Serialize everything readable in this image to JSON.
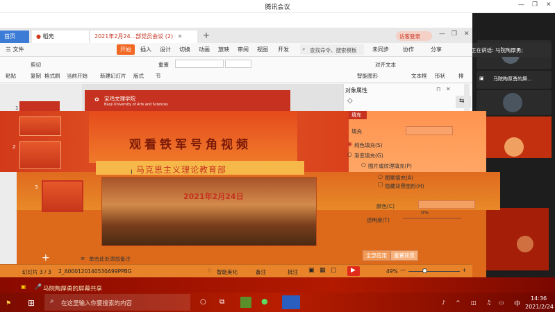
{
  "meeting": {
    "title": "腾讯会议",
    "speaking_label": "正在讲话: 马院陶厚勇;",
    "participant_name": "马院陶厚勇的屏...",
    "shared_screen_label": "马院陶厚勇的屏幕共享"
  },
  "wps": {
    "tabs": [
      "首页",
      "稻壳",
      "2021年2月24...部党员会议 (2)"
    ],
    "login_button": "访客登录",
    "menu": [
      "三 文件",
      "开始",
      "插入",
      "设计",
      "切换",
      "动画",
      "放映",
      "审阅",
      "视图",
      "开发"
    ],
    "search_placeholder": "查找命令、搜索模板",
    "sync_status": "未同步",
    "collab": "协作",
    "share": "分享",
    "toolbar": {
      "paste": "粘贴",
      "cut": "剪切",
      "copy": "复制",
      "format_painter": "格式刷",
      "from_current": "当前开始",
      "new_slide": "新建幻灯片",
      "layout": "版式",
      "section": "节",
      "reset": "重置",
      "text_box": "文本框",
      "shape": "形状",
      "arrange": "排",
      "align_text": "对齐文本",
      "smart_graphic": "智能图形"
    },
    "props": {
      "title": "对象属性",
      "fill_tab": "填充",
      "fill_label": "填充",
      "solid_fill": "纯色填充(S)",
      "gradient_fill": "渐变填充(G)",
      "picture_fill": "图片或纹理填充(P)",
      "pattern_fill": "图案填充(A)",
      "hide_bg": "隐藏背景图形(H)",
      "color_label": "颜色(C)",
      "transparency_label": "透明度(T)",
      "transparency_value": "0%",
      "apply_all": "全部应用",
      "reset_bg": "重置背景"
    },
    "slides": {
      "slide1_num": "1",
      "slide2_num": "2",
      "slide3_num": "3",
      "school_name": "宝鸡文理学院",
      "school_en": "Baoji University of Arts and Sciences",
      "main_title": "观看铁军号角视频",
      "subtitle": "马克思主义理论教育部",
      "date": "2021年2月24日"
    },
    "notes_placeholder": "单击此处添加备注",
    "status": {
      "slide_count": "幻灯片 3 / 3",
      "file": "2_A000120140530A99PPBG",
      "beautify": "智能美化",
      "notes": "备注",
      "comments": "批注",
      "zoom": "49%"
    }
  },
  "taskbar": {
    "search_placeholder": "在这里输入你要搜索的内容",
    "time": "14:36",
    "date": "2021/2/24",
    "ime": "中"
  },
  "colors": {
    "wps_accent": "#c6321f",
    "tab_active": "#3c7cd6",
    "start_tab": "#f26722"
  }
}
